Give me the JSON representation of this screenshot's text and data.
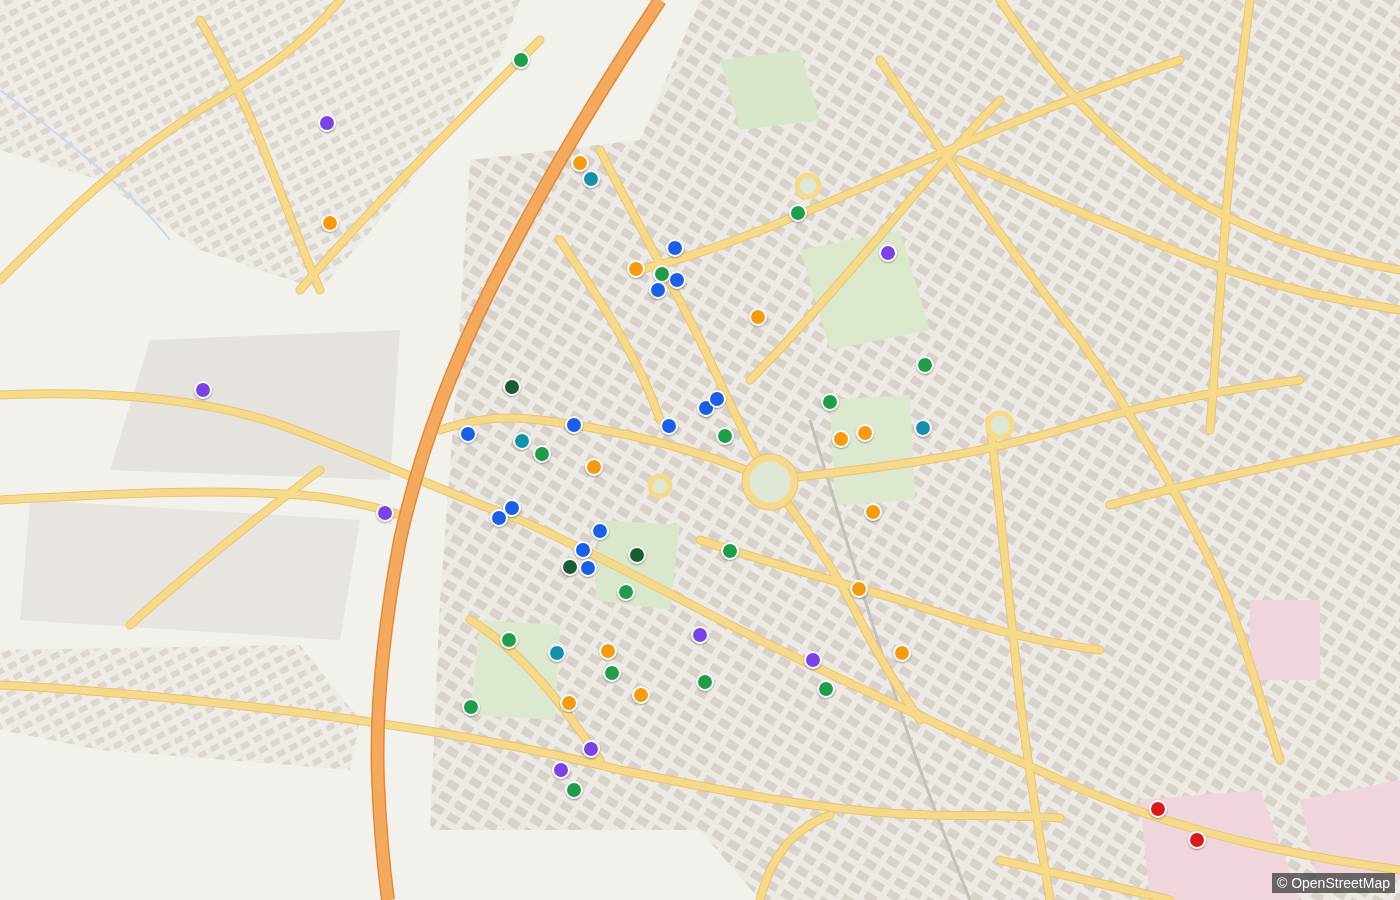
{
  "map": {
    "markers": [
      {
        "color": "#1f9d4a"
      },
      {
        "color": "#7b42e6"
      },
      {
        "color": "#f39c12"
      },
      {
        "color": "#168fa8"
      },
      {
        "color": "#f39c12"
      },
      {
        "color": "#1a5fe6"
      },
      {
        "color": "#f39c12"
      },
      {
        "color": "#1a5fe6"
      },
      {
        "color": "#1f9d4a"
      },
      {
        "color": "#1a5fe6"
      },
      {
        "color": "#f39c12"
      },
      {
        "color": "#1f9d4a"
      },
      {
        "color": "#7b42e6"
      },
      {
        "color": "#1f9d4a"
      },
      {
        "color": "#7b42e6"
      },
      {
        "color": "#1a5c33"
      },
      {
        "color": "#1f9d4a"
      },
      {
        "color": "#1a5fe6"
      },
      {
        "color": "#1a5fe6"
      },
      {
        "color": "#1f9d4a"
      },
      {
        "color": "#1a5fe6"
      },
      {
        "color": "#1a5fe6"
      },
      {
        "color": "#1a5fe6"
      },
      {
        "color": "#168fa8"
      },
      {
        "color": "#1f9d4a"
      },
      {
        "color": "#f39c12"
      },
      {
        "color": "#f39c12"
      },
      {
        "color": "#168fa8"
      },
      {
        "color": "#f39c12"
      },
      {
        "color": "#7b42e6"
      },
      {
        "color": "#1a5fe6"
      },
      {
        "color": "#1a5fe6"
      },
      {
        "color": "#1a5fe6"
      },
      {
        "color": "#f39c12"
      },
      {
        "color": "#1a5fe6"
      },
      {
        "color": "#1a5c33"
      },
      {
        "color": "#1a5c33"
      },
      {
        "color": "#1a5fe6"
      },
      {
        "color": "#1f9d4a"
      },
      {
        "color": "#1f9d4a"
      },
      {
        "color": "#f39c12"
      },
      {
        "color": "#7b42e6"
      },
      {
        "color": "#1f9d4a"
      },
      {
        "color": "#168fa8"
      },
      {
        "color": "#f39c12"
      },
      {
        "color": "#7b42e6"
      },
      {
        "color": "#f39c12"
      },
      {
        "color": "#1f9d4a"
      },
      {
        "color": "#1f9d4a"
      },
      {
        "color": "#f39c12"
      },
      {
        "color": "#1f9d4a"
      },
      {
        "color": "#f39c12"
      },
      {
        "color": "#1f9d4a"
      },
      {
        "color": "#7b42e6"
      },
      {
        "color": "#7b42e6"
      },
      {
        "color": "#1f9d4a"
      },
      {
        "color": "#d91a1a"
      },
      {
        "color": "#d91a1a"
      }
    ]
  },
  "attribution": {
    "text": "© OpenStreetMap"
  }
}
